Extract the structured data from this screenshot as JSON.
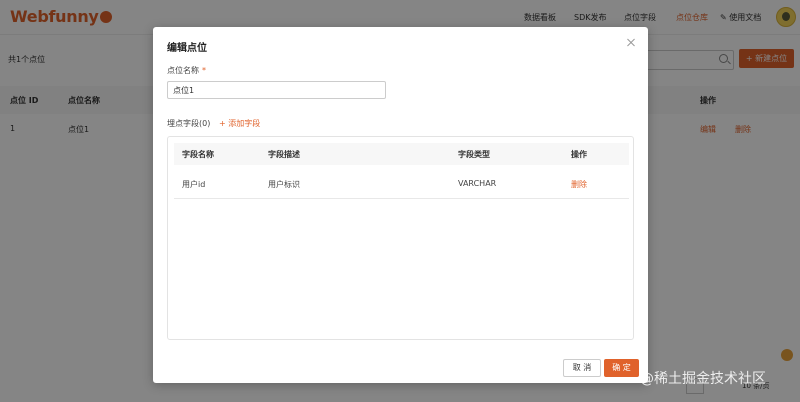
{
  "app": {
    "logo_text": "Webfunny",
    "nav": [
      {
        "label": "数据看板"
      },
      {
        "label": "SDK发布"
      },
      {
        "label": "点位字段"
      },
      {
        "label": "点位仓库"
      },
      {
        "label": "使用文档"
      }
    ],
    "active_nav": "点位仓库",
    "accent_color": "#e0622b"
  },
  "page": {
    "count_text": "共1个点位",
    "search": {
      "placeholder": ""
    },
    "new_button_label": "+ 新建点位",
    "table": {
      "headers": [
        "点位 ID",
        "点位名称",
        "操作"
      ],
      "rows": [
        {
          "id": "1",
          "name": "点位1",
          "actions": [
            "编辑",
            "删除"
          ]
        }
      ]
    },
    "pagination_text": "10 条/页"
  },
  "modal": {
    "title": "编辑点位",
    "name_label": "点位名称",
    "required_mark": "*",
    "name_value": "点位1",
    "fields_label": "埋点字段(0)",
    "add_field_link": "+ 添加字段",
    "fields_table": {
      "headers": [
        "字段名称",
        "字段描述",
        "字段类型",
        "操作"
      ],
      "rows": [
        {
          "name": "用户id",
          "description": "用户标识",
          "type": "VARCHAR",
          "action": "删除"
        }
      ]
    },
    "cancel_label": "取 消",
    "confirm_label": "确 定"
  },
  "watermark": "@稀土掘金技术社区",
  "icons": {
    "close": "close-icon",
    "search": "search-icon",
    "doc": "doc-icon",
    "avatar": "avatar-icon"
  }
}
